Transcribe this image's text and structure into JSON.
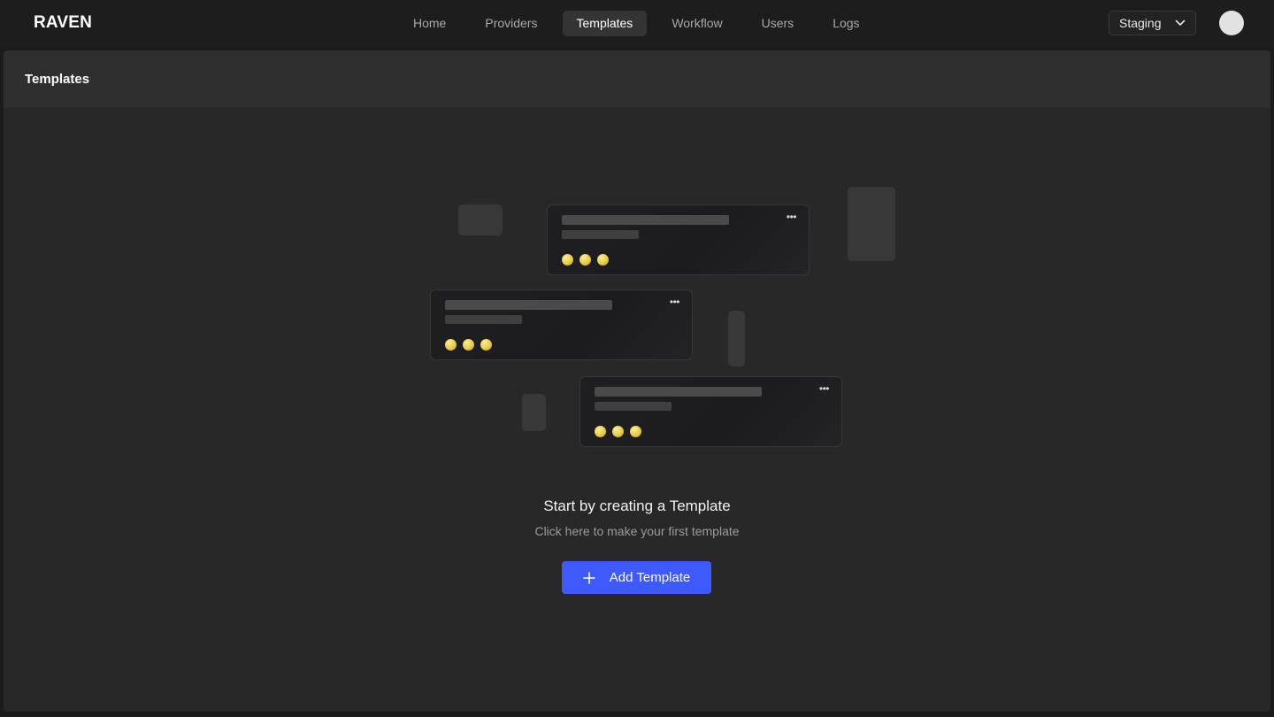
{
  "app": {
    "brand": "RAVEN"
  },
  "nav": {
    "items": [
      {
        "label": "Home",
        "active": false
      },
      {
        "label": "Providers",
        "active": false
      },
      {
        "label": "Templates",
        "active": true
      },
      {
        "label": "Workflow",
        "active": false
      },
      {
        "label": "Users",
        "active": false
      },
      {
        "label": "Logs",
        "active": false
      }
    ]
  },
  "environment": {
    "selected": "Staging",
    "icon": "chevron-down-icon"
  },
  "page": {
    "title": "Templates"
  },
  "empty_state": {
    "title": "Start by creating a Template",
    "subtitle": "Click here to make your first template",
    "button_label": "Add Template",
    "button_icon": "plus-icon"
  },
  "colors": {
    "accent": "#3f5afc",
    "background": "#282828",
    "header": "#2f2f2f",
    "topbar": "#1d1d1d"
  }
}
